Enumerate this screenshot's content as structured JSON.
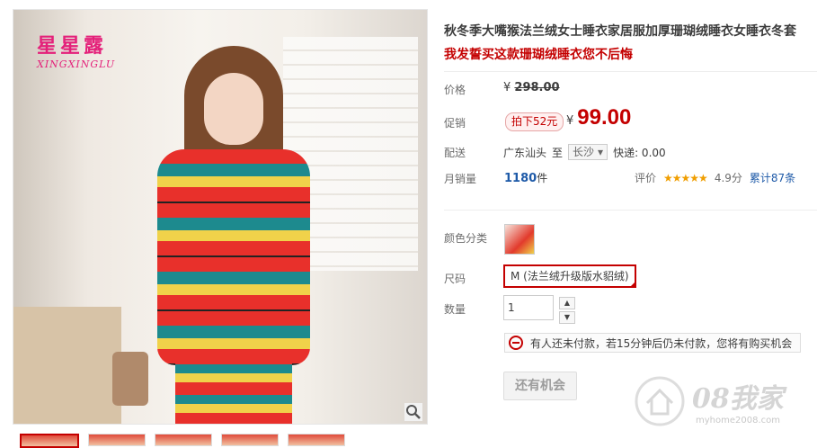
{
  "product": {
    "title": "秋冬季大嘴猴法兰绒女士睡衣家居服加厚珊瑚绒睡衣女睡衣冬套",
    "subtitle": "我发誓买这款珊瑚绒睡衣您不后悔"
  },
  "brand": {
    "logo_text": "星星露",
    "logo_sub": "XINGXINGLU"
  },
  "price": {
    "label": "价格",
    "original": "298.00",
    "currency": "¥"
  },
  "promo": {
    "label": "促销",
    "badge": "拍下52元",
    "currency": "¥",
    "value": "99.00"
  },
  "shipping": {
    "label": "配送",
    "from": "广东汕头",
    "to_word": "至",
    "to": "长沙",
    "express": "快递: 0.00"
  },
  "sales": {
    "label": "月销量",
    "count": "1180",
    "unit": "件",
    "rating_label": "评价",
    "stars": "★★★★★",
    "score": "4.9分",
    "reviews_link": "累计87条"
  },
  "options": {
    "color_label": "颜色分类",
    "size_label": "尺码",
    "size_value": "M (法兰绒升级版水貂绒)",
    "qty_label": "数量",
    "qty_value": "1",
    "qty_up": "▲",
    "qty_down": "▼"
  },
  "notice": {
    "text": "有人还未付款，若15分钟后仍未付款，您将有购买机会"
  },
  "cta": {
    "label": "还有机会"
  },
  "watermark": {
    "text": "08我家",
    "url": "myhome2008.com"
  },
  "colors": {
    "accent": "#c40000",
    "link": "#1e5aa8",
    "brand": "#e4217a",
    "star": "#f09e00"
  }
}
